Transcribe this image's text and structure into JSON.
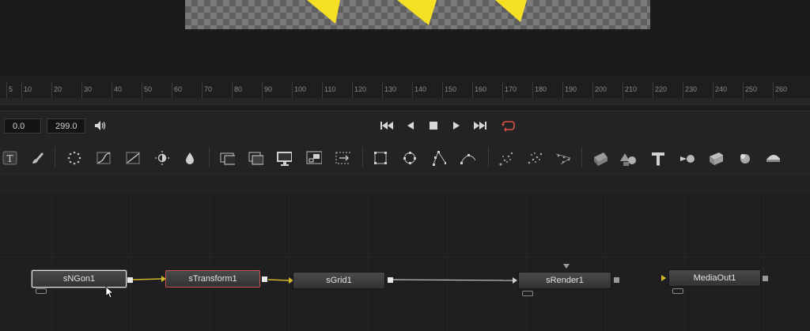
{
  "viewer": {
    "checker_colors": [
      "#7a7a7a",
      "#5f5f5f"
    ],
    "shape_color": "#f5e024"
  },
  "ruler": {
    "ticks": [
      "5",
      "10",
      "20",
      "30",
      "40",
      "50",
      "60",
      "70",
      "80",
      "90",
      "100",
      "110",
      "120",
      "130",
      "140",
      "150",
      "160",
      "170",
      "180",
      "190",
      "200",
      "210",
      "220",
      "230",
      "240",
      "250",
      "260"
    ]
  },
  "transport": {
    "start_frame": "0.0",
    "end_frame": "299.0",
    "buttons": [
      "audio-icon",
      "skip-to-start-icon",
      "play-reverse-icon",
      "stop-icon",
      "play-forward-icon",
      "skip-to-end-icon",
      "loop-icon"
    ],
    "loop_color": "#d8523f"
  },
  "toolbar": {
    "tools": [
      "text-tool-icon",
      "paint-tool-icon",
      "particles-icon",
      "color-curves-icon",
      "gradient-icon",
      "brightness-contrast-icon",
      "blur-drop-icon",
      "merge-icon",
      "background-layers-icon",
      "viewer-monitor-icon",
      "resize-icon",
      "transform-icon",
      "rectangle-mask-icon",
      "ellipse-mask-icon",
      "polygon-mask-icon",
      "bspline-mask-icon",
      "particle-emitter-icon",
      "particle-render-icon",
      "particle-style-icon",
      "shape3d-icon",
      "merge3d-icon",
      "text3d-icon",
      "camera3d-icon",
      "renderer3d-icon",
      "light-icon",
      "image-plane-icon"
    ]
  },
  "nodes": {
    "sngon": "sNGon1",
    "stransform": "sTransform1",
    "sgrid": "sGrid1",
    "srender": "sRender1",
    "mediaout": "MediaOut1"
  },
  "colors": {
    "link_yellow": "#d2b62a",
    "link_white": "#cfcfcf",
    "active_border": "#c9544d"
  }
}
